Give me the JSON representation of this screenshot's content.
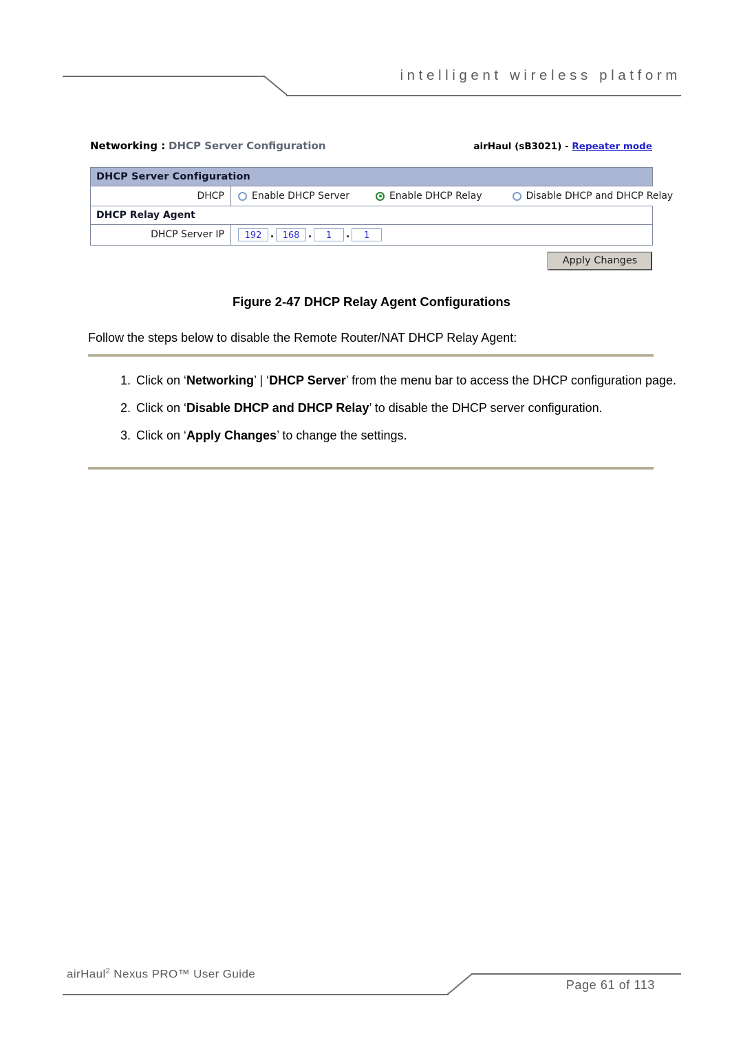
{
  "header": {
    "tagline": "intelligent wireless platform"
  },
  "figure": {
    "screen": {
      "breadcrumb_bold": "Networking :",
      "breadcrumb_page": "DHCP Server Configuration",
      "device_label": "airHaul (sB3021) -",
      "mode_link": "Repeater mode",
      "panel_title": "DHCP Server Configuration",
      "dhcp_row_label": "DHCP",
      "radio_options": [
        {
          "label": "Enable DHCP Server",
          "selected": false
        },
        {
          "label": "Enable DHCP Relay",
          "selected": true
        },
        {
          "label": "Disable DHCP and DHCP Relay",
          "selected": false
        }
      ],
      "relay_section_title": "DHCP Relay Agent",
      "server_ip_label": "DHCP Server IP",
      "server_ip_octets": [
        "192",
        "168",
        "1",
        "1"
      ],
      "octet_separator": ".",
      "apply_button": "Apply Changes",
      "colors": {
        "panel_title_bg": "#aab6d4",
        "panel_border": "#7f88a0",
        "input_text": "#2a2ad0",
        "input_border": "#8fa8cc",
        "radio_border": "#7b9ec7",
        "radio_selected": "#12a012",
        "link": "#2222cc",
        "button_face": "#d4d0c8"
      }
    },
    "caption": "Figure 2-47 DHCP Relay Agent Configurations"
  },
  "body": {
    "intro": "Follow the steps below to disable the Remote Router/NAT DHCP Relay Agent:",
    "steps": [
      {
        "number": "1.",
        "parts": [
          {
            "text": "Click on ‘",
            "bold": false
          },
          {
            "text": "Networking",
            "bold": true
          },
          {
            "text": "’ | ‘",
            "bold": false
          },
          {
            "text": "DHCP Server",
            "bold": true
          },
          {
            "text": "’ from the menu bar to access the DHCP configuration page.",
            "bold": false
          }
        ]
      },
      {
        "number": "2.",
        "parts": [
          {
            "text": "Click on ‘",
            "bold": false
          },
          {
            "text": "Disable DHCP and DHCP Relay",
            "bold": true
          },
          {
            "text": "’ to disable the DHCP server configuration.",
            "bold": false
          }
        ]
      },
      {
        "number": "3.",
        "parts": [
          {
            "text": "Click on ‘",
            "bold": false
          },
          {
            "text": "Apply Changes",
            "bold": true
          },
          {
            "text": "’ to change the settings.",
            "bold": false
          }
        ]
      }
    ],
    "rule_color": "#b2ad94"
  },
  "footer": {
    "guide_prefix": "airHaul",
    "guide_sup": "2",
    "guide_suffix": " Nexus PRO™ User Guide",
    "page_label": "Page 61 of 113"
  }
}
